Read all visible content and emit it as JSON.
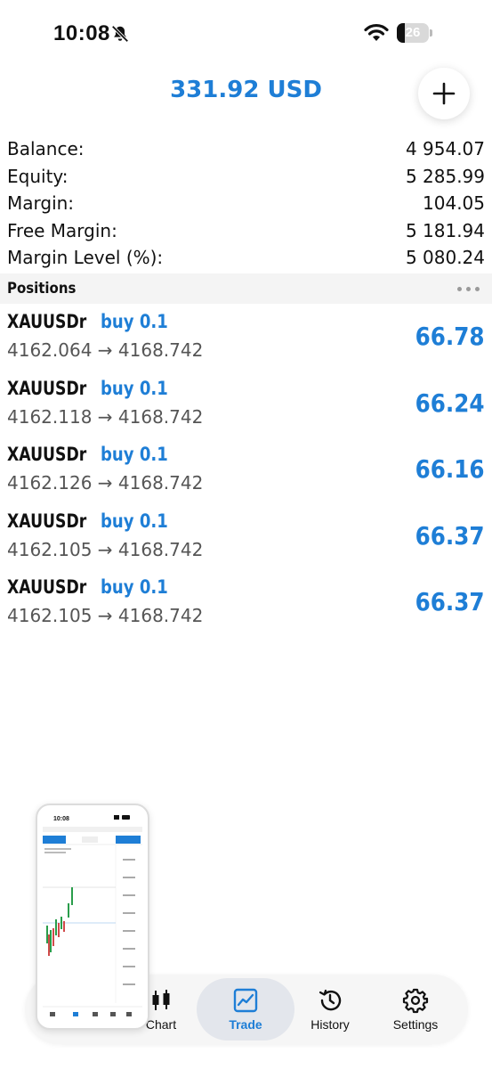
{
  "status_bar": {
    "time": "10:08",
    "battery_level": "26",
    "battery_fraction": 0.26,
    "icons": [
      "bell-slash-icon",
      "wifi-icon",
      "battery-icon"
    ]
  },
  "header": {
    "title": "331.92 USD",
    "add_icon": "plus-icon"
  },
  "summary": [
    {
      "label": "Balance:",
      "value": "4 954.07"
    },
    {
      "label": "Equity:",
      "value": "5 285.99"
    },
    {
      "label": "Margin:",
      "value": "104.05"
    },
    {
      "label": "Free Margin:",
      "value": "5 181.94"
    },
    {
      "label": "Margin Level (%):",
      "value": "5 080.24"
    }
  ],
  "positions": {
    "title": "Positions",
    "more_icon": "more-horizontal-icon",
    "items": [
      {
        "symbol": "XAUUSDr",
        "type": "buy 0.1",
        "prices": "4162.064 → 4168.742",
        "profit": "66.78"
      },
      {
        "symbol": "XAUUSDr",
        "type": "buy 0.1",
        "prices": "4162.118 → 4168.742",
        "profit": "66.24"
      },
      {
        "symbol": "XAUUSDr",
        "type": "buy 0.1",
        "prices": "4162.126 → 4168.742",
        "profit": "66.16"
      },
      {
        "symbol": "XAUUSDr",
        "type": "buy 0.1",
        "prices": "4162.105 → 4168.742",
        "profit": "66.37"
      },
      {
        "symbol": "XAUUSDr",
        "type": "buy 0.1",
        "prices": "4162.105 → 4168.742",
        "profit": "66.37"
      }
    ]
  },
  "bottom_nav": {
    "items": [
      {
        "label": "Chart",
        "icon": "candlestick-icon",
        "active": false
      },
      {
        "label": "Trade",
        "icon": "trend-chart-icon",
        "active": true
      },
      {
        "label": "History",
        "icon": "history-icon",
        "active": false
      },
      {
        "label": "Settings",
        "icon": "gear-icon",
        "active": false
      }
    ]
  },
  "pip": {
    "time": "10:08",
    "icon": "chart-screenshot-thumbnail"
  },
  "colors": {
    "accent": "#1e7ed6",
    "text": "#111111",
    "muted": "#555555",
    "section_bg": "#f4f4f4",
    "nav_bg": "#f6f6f6",
    "nav_active_bg": "#e3e6ec"
  }
}
